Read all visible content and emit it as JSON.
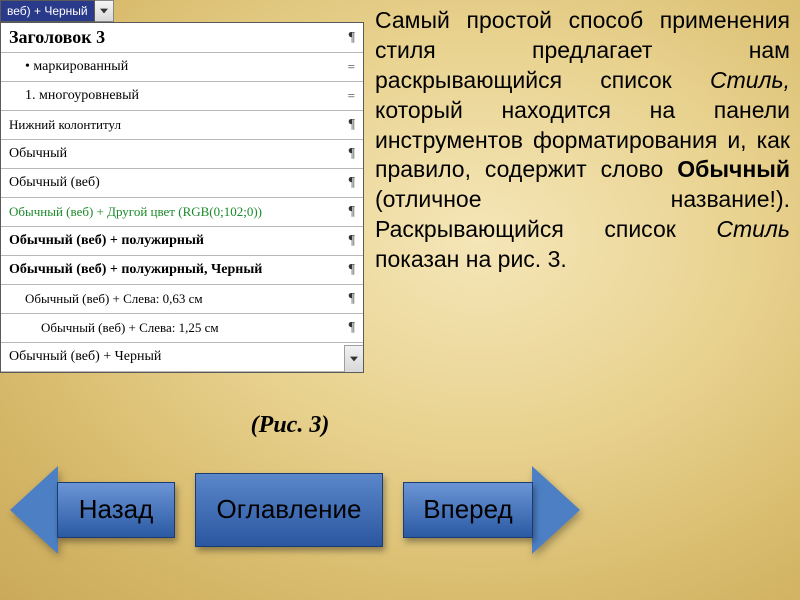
{
  "dropdown": {
    "selected": "веб) + Черный"
  },
  "styles": {
    "heading3": "Заголовок 3",
    "bulleted": "маркированный",
    "numbered": "1.  многоуровневый",
    "footer": "Нижний колонтитул",
    "normal": "Обычный",
    "normal_web": "Обычный (веб)",
    "normal_web_color": "Обычный (веб) + Другой цвет (RGB(0;102;0))",
    "normal_web_bold": "Обычный (веб) + полужирный",
    "normal_web_bold_black": "Обычный (веб) + полужирный, Черный",
    "normal_web_indent1": "Обычный (веб) + Слева:  0,63 см",
    "normal_web_indent2": "Обычный (веб) + Слева:  1,25 см",
    "normal_web_black": "Обычный (веб) + Черный",
    "eq_marker": "="
  },
  "pilcrow": "¶",
  "caption": "(Рис. 3)",
  "desc": {
    "t1": "Самый простой способ применения стиля предлагает нам раскрывающийся список ",
    "style_word": "Стиль,",
    "t2": " который находится на панели инструментов форматирования и, как правило, содержит слово ",
    "bold_word": "Обычный",
    "t3": " (отличное название!). Раскрывающийся список ",
    "style_word2": "Стиль",
    "t4": " показан на рис. 3."
  },
  "nav": {
    "back": "Назад",
    "toc": "Оглавление",
    "forward": "Вперед"
  }
}
